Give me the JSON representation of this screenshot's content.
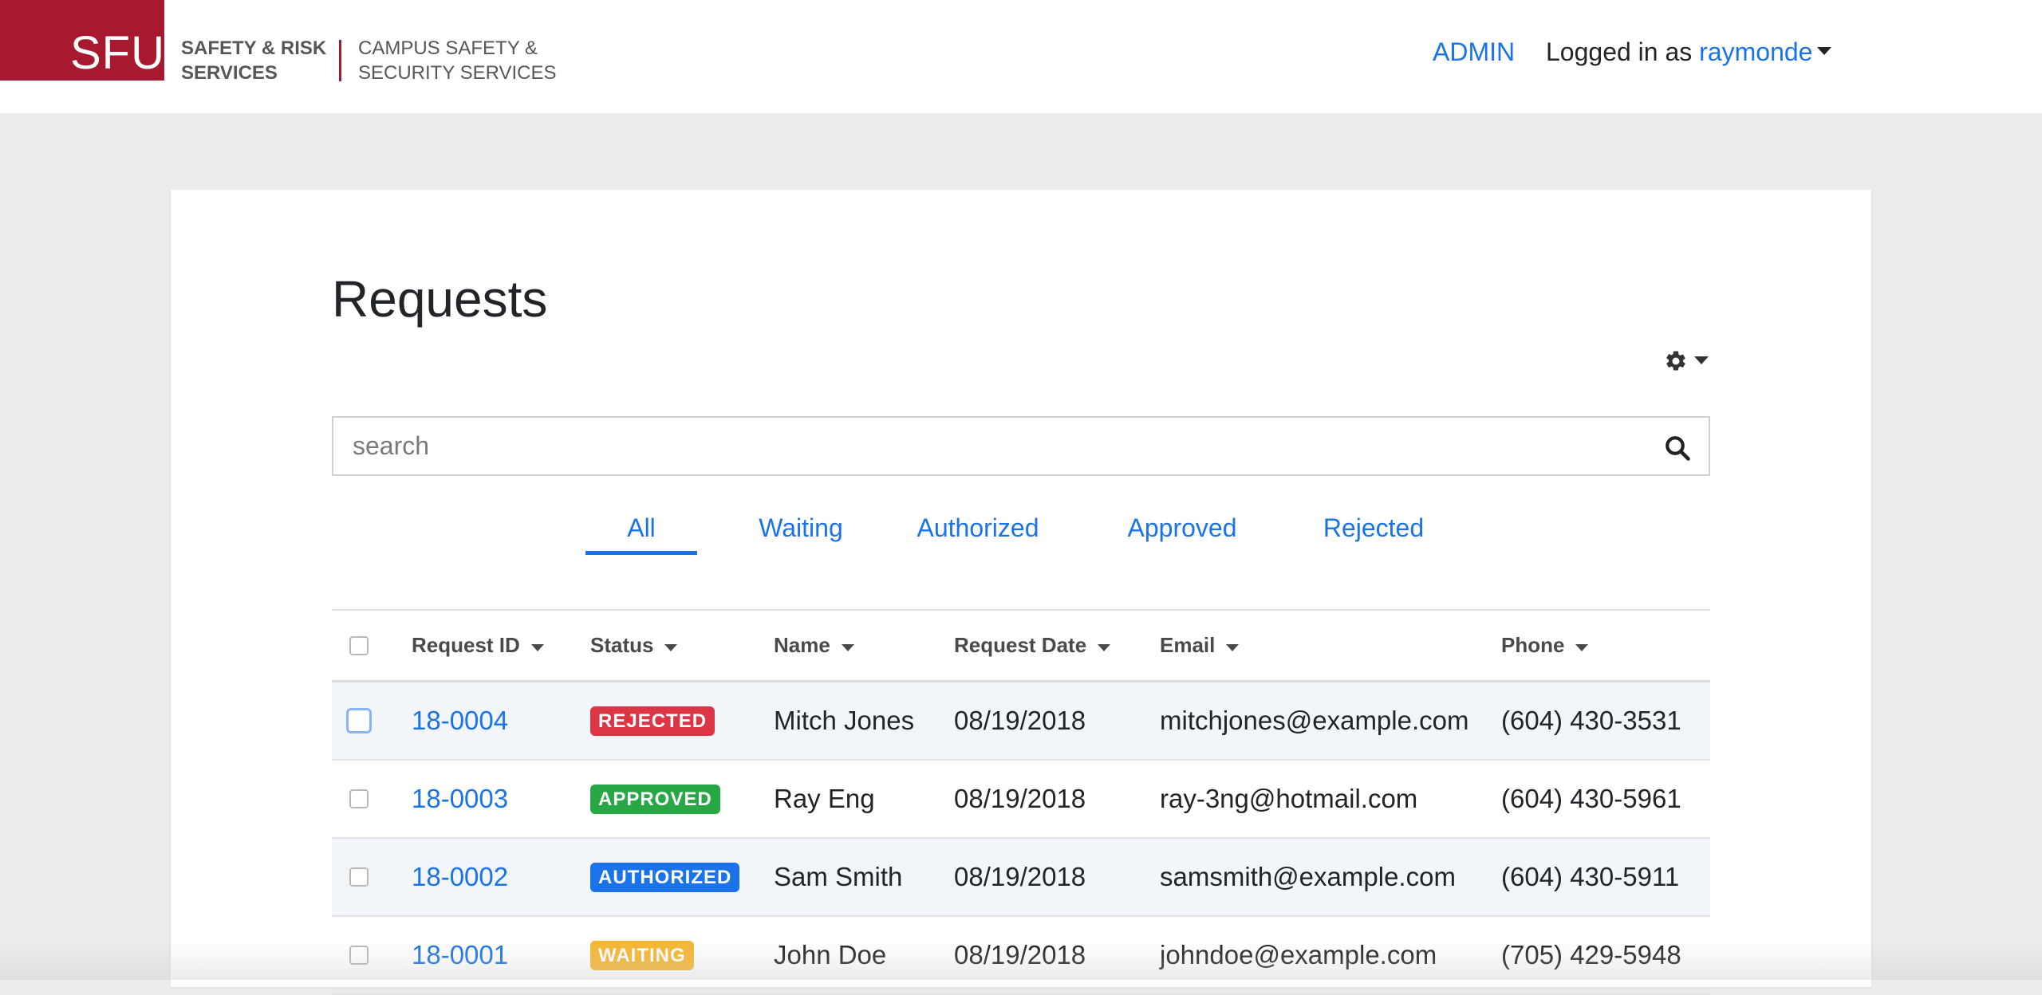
{
  "header": {
    "logo_text": "SFU",
    "org_primary_line1": "SAFETY & RISK",
    "org_primary_line2": "SERVICES",
    "org_secondary_line1": "CAMPUS SAFETY &",
    "org_secondary_line2": "SECURITY SERVICES",
    "admin_link": "ADMIN",
    "logged_in_prefix": "Logged in as",
    "username": "raymonde"
  },
  "page": {
    "title": "Requests",
    "settings_icon": "gear-icon"
  },
  "search": {
    "placeholder": "search",
    "value": "",
    "icon": "search-icon"
  },
  "tabs": [
    {
      "label": "All",
      "active": true
    },
    {
      "label": "Waiting",
      "active": false
    },
    {
      "label": "Authorized",
      "active": false
    },
    {
      "label": "Approved",
      "active": false
    },
    {
      "label": "Rejected",
      "active": false
    }
  ],
  "table": {
    "columns": [
      "Request ID",
      "Status",
      "Name",
      "Request Date",
      "Email",
      "Phone"
    ],
    "rows": [
      {
        "id": "18-0004",
        "status": "REJECTED",
        "name": "Mitch Jones",
        "date": "08/19/2018",
        "email": "mitchjones@example.com",
        "phone": "(604) 430-3531"
      },
      {
        "id": "18-0003",
        "status": "APPROVED",
        "name": "Ray Eng",
        "date": "08/19/2018",
        "email": "ray-3ng@hotmail.com",
        "phone": "(604) 430-5961"
      },
      {
        "id": "18-0002",
        "status": "AUTHORIZED",
        "name": "Sam Smith",
        "date": "08/19/2018",
        "email": "samsmith@example.com",
        "phone": "(604) 430-5911"
      },
      {
        "id": "18-0001",
        "status": "WAITING",
        "name": "John Doe",
        "date": "08/19/2018",
        "email": "johndoe@example.com",
        "phone": "(705) 429-5948"
      }
    ]
  },
  "colors": {
    "brand_red": "#a6192e",
    "link_blue": "#1a73e8",
    "status_rejected": "#dc3545",
    "status_approved": "#28a745",
    "status_authorized": "#1a73e8",
    "status_waiting": "#f5b731"
  }
}
